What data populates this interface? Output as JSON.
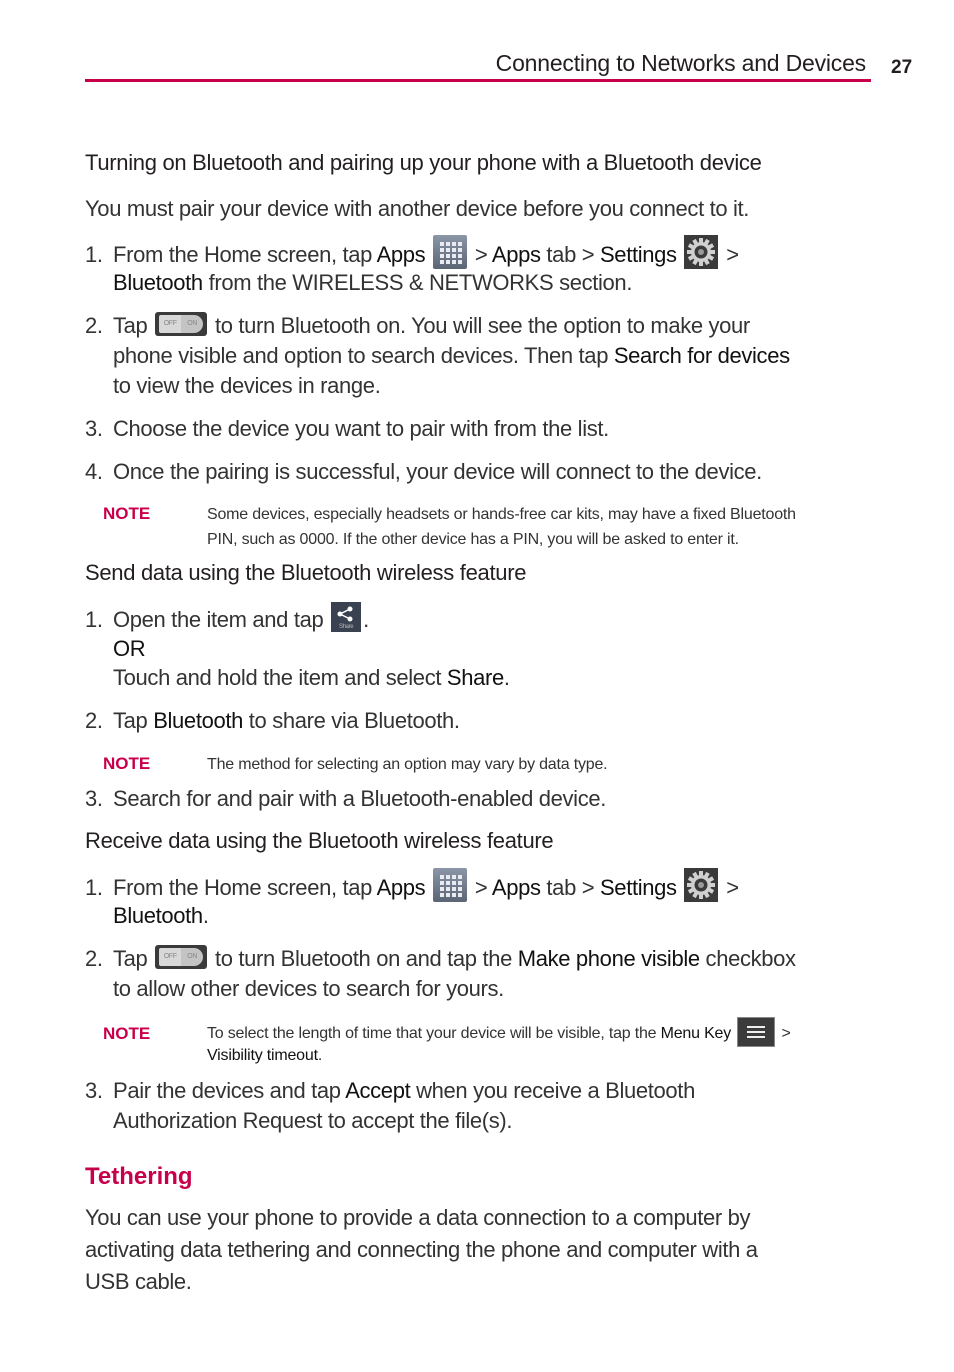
{
  "header": {
    "title": "Connecting to Networks and Devices",
    "page_number": "27",
    "accent_color": "#c8004b"
  },
  "section1": {
    "heading": "Turning on Bluetooth and pairing up your phone with a Bluetooth device",
    "intro": "You must pair your device with another device before you connect to it.",
    "steps": [
      {
        "num": "1.",
        "line1": [
          "From the Home screen, tap ",
          "Apps",
          " > ",
          "Apps",
          " tab > ",
          "Settings",
          " >"
        ],
        "line2": [
          "Bluetooth",
          " from the WIRELESS & NETWORKS section."
        ]
      },
      {
        "num": "2.",
        "line1": [
          "Tap",
          " to turn Bluetooth on. You will see the option to make your"
        ],
        "line2": [
          "phone visible and option to search devices. Then tap ",
          "Search for devices"
        ],
        "line3": "to view the devices in range."
      },
      {
        "num": "3.",
        "text": "Choose the device you want to pair with from the list."
      },
      {
        "num": "4.",
        "text": "Once the pairing is successful, your device will connect to the device."
      }
    ],
    "note": {
      "label": "NOTE",
      "line1": "Some devices, especially headsets or hands-free car kits, may have a fixed Bluetooth",
      "line2": "PIN, such as 0000. If the other device has a PIN, you will be asked to enter it."
    }
  },
  "section2": {
    "heading": "Send data using the Bluetooth wireless feature",
    "steps": [
      {
        "num": "1.",
        "line1": [
          "Open the item and tap",
          "."
        ],
        "or": "OR",
        "line3": [
          "Touch and hold the item and select ",
          "Share",
          "."
        ]
      },
      {
        "num": "2.",
        "line1": [
          "Tap ",
          "Bluetooth",
          " to share via Bluetooth."
        ]
      },
      {
        "num": "3.",
        "text": "Search for and pair with a Bluetooth-enabled device."
      }
    ],
    "note": {
      "label": "NOTE",
      "text": "The method for selecting an option may vary by data type."
    }
  },
  "section3": {
    "heading": "Receive data using the Bluetooth wireless feature",
    "steps": [
      {
        "num": "1.",
        "line1": [
          "From the Home screen, tap ",
          "Apps",
          " > ",
          "Apps",
          " tab > ",
          "Settings",
          " >"
        ],
        "line2": [
          "Bluetooth",
          "."
        ]
      },
      {
        "num": "2.",
        "line1": [
          "Tap",
          " to turn Bluetooth on and tap the ",
          "Make phone visible",
          " checkbox"
        ],
        "line2": "to allow other devices to search for yours."
      },
      {
        "num": "3.",
        "line1": [
          "Pair the devices and tap ",
          "Accept",
          " when you receive a Bluetooth"
        ],
        "line2": "Authorization Request to accept the file(s)."
      }
    ],
    "note": {
      "label": "NOTE",
      "line1": [
        "To select the length of time that your device will be visible, tap the ",
        "Menu Key",
        " >"
      ],
      "line2": [
        "Visibility timeout",
        "."
      ]
    }
  },
  "tethering": {
    "title": "Tethering",
    "lines": [
      "You can use your phone to provide a data connection to a computer by",
      "activating data tethering and connecting the phone and computer with a",
      "USB cable."
    ]
  },
  "icons": {
    "apps": "apps-grid-icon",
    "settings": "settings-gear-icon",
    "toggle": "bluetooth-toggle-icon",
    "toggle_off": "OFF",
    "toggle_on": "ON",
    "share": "share-icon",
    "share_label": "Share",
    "menu": "menu-key-icon"
  }
}
